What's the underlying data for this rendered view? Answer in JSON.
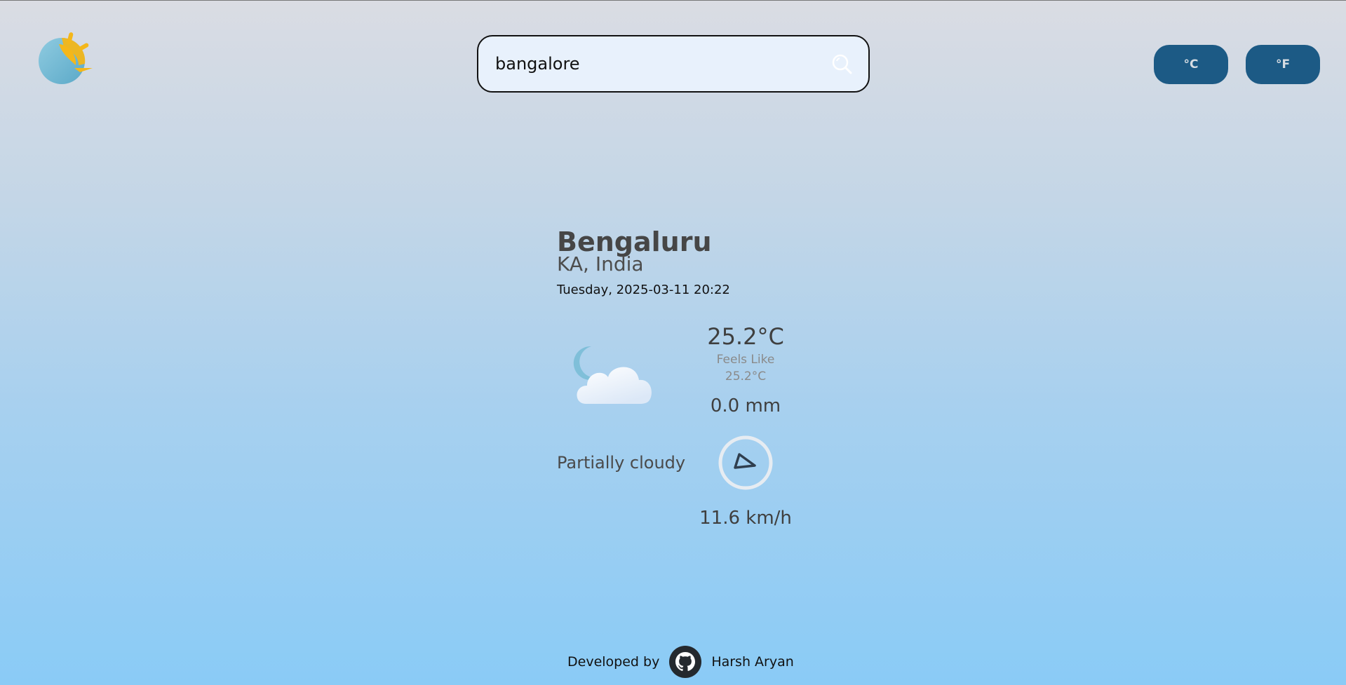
{
  "header": {
    "logo": "sun-moon-logo-icon",
    "search": {
      "value": "bangalore",
      "placeholder": "",
      "icon": "search-icon"
    },
    "units": [
      {
        "label": "°C",
        "color": "#1c5a85"
      },
      {
        "label": "°F",
        "color": "#1c5a85"
      }
    ]
  },
  "location": {
    "city": "Bengaluru",
    "region": "KA, India",
    "datetime": "Tuesday, 2025-03-11 20:22"
  },
  "weather": {
    "icon": "partly-cloudy-night-icon",
    "temperature": "25.2°C",
    "feels_like_label": "Feels Like",
    "feels_like_value": "25.2°C",
    "precipitation": "0.0 mm",
    "condition": "Partially cloudy",
    "wind_icon": "wind-direction-icon",
    "wind_speed": "11.6 km/h"
  },
  "footer": {
    "developed_by": "Developed by",
    "github_icon": "github-icon",
    "author": "Harsh Aryan"
  }
}
